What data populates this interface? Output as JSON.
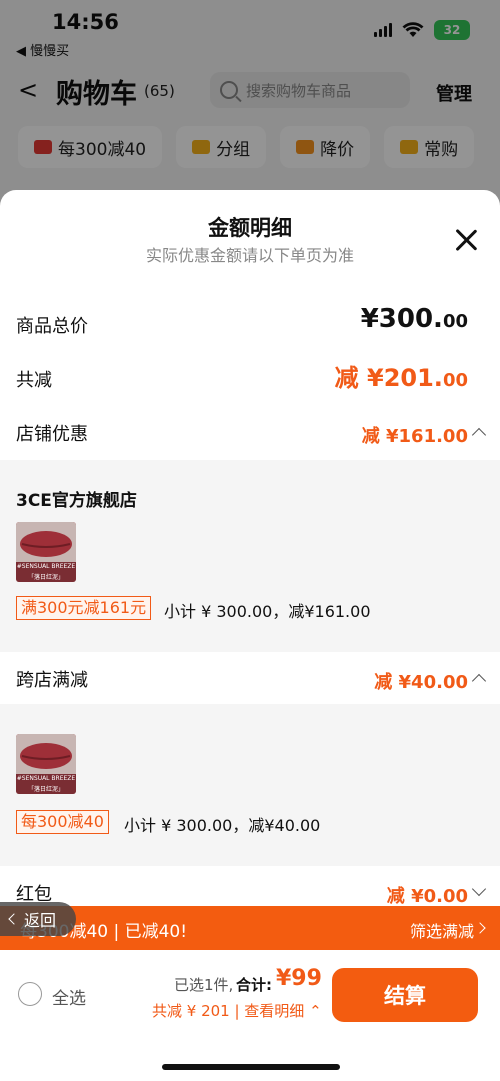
{
  "status": {
    "time": "14:56",
    "back_app": "◀ 慢慢买",
    "battery": "32"
  },
  "header": {
    "title": "购物车",
    "count": "(65)",
    "search_placeholder": "搜索购物车商品",
    "manage": "管理"
  },
  "chips": [
    {
      "label": "每300减40",
      "color": "#e53935"
    },
    {
      "label": "分组",
      "color": "#f6b21b"
    },
    {
      "label": "降价",
      "color": "#f7931e"
    },
    {
      "label": "常购",
      "color": "#f6b21b"
    }
  ],
  "sheet": {
    "title": "金额明细",
    "subtitle": "实际优惠金额请以下单页为准",
    "goods_total_label": "商品总价",
    "goods_total_main": "¥300.",
    "goods_total_dec": "00",
    "reduce_label": "共减",
    "reduce_main": "减 ¥201.",
    "reduce_dec": "00",
    "store_discount_label": "店铺优惠",
    "store_discount_value": "减 ¥161.00",
    "shop_name": "3CE官方旗舰店",
    "thumb_caption_1": "#SENSUAL BREEZE",
    "thumb_caption_2": "「落日红泥」",
    "store_promo_tag": "满300元减161元",
    "store_subtotal": "小计 ¥ 300.00，减¥161.00",
    "cross_label": "跨店满减",
    "cross_value": "减 ¥40.00",
    "cross_promo_tag": "每300减40",
    "cross_subtotal": "小计 ¥ 300.00，减¥40.00",
    "redpacket_label": "红包",
    "redpacket_value": "减 ¥0.00"
  },
  "promo_bar": {
    "text": "每300减40 | 已减40!",
    "link": "筛选满减"
  },
  "back_pill": {
    "label": "返回"
  },
  "checkout": {
    "select_all": "全选",
    "selected": "已选1件,",
    "total_label": "合计:",
    "total_price": "¥99",
    "reduce_line": "共减 ¥ 201 | 查看明细 ⌃",
    "button": "结算"
  }
}
